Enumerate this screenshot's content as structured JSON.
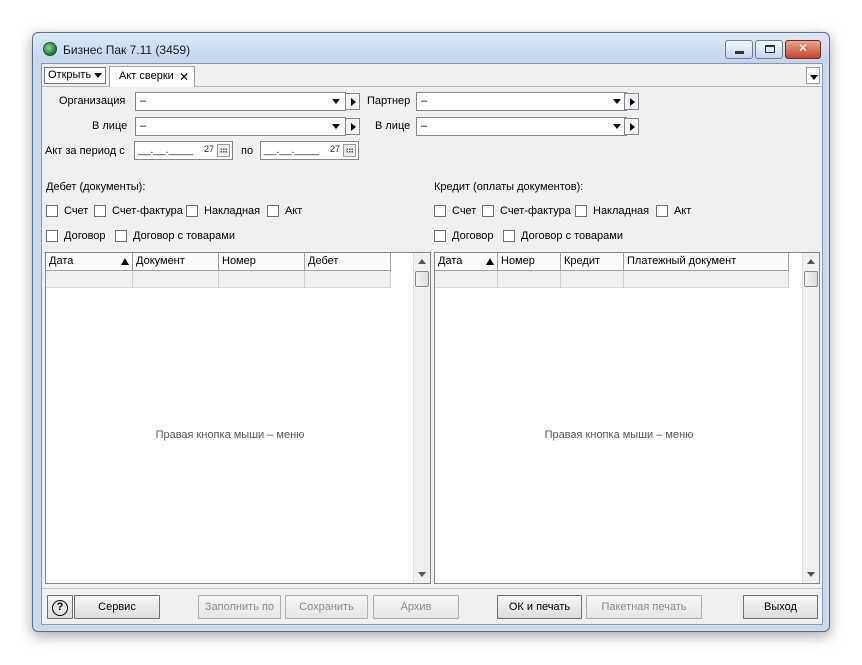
{
  "window": {
    "title": "Бизнес Пак 7.11 (3459)"
  },
  "tabs": {
    "open_label": "Открыть",
    "doc_tab_label": "Акт сверки",
    "close_glyph": "✕"
  },
  "form": {
    "org_label": "Организация",
    "org_value": "–",
    "partner_label": "Партнер",
    "partner_value": "–",
    "face_label_left": "В лице",
    "face_value_left": "–",
    "face_label_right": "В лице",
    "face_value_right": "–",
    "period_label": "Акт за период с",
    "date_from": "__.__.____",
    "date_from_day": "27",
    "to_label": "по",
    "date_to": "__.__.____",
    "date_to_day": "27"
  },
  "debit": {
    "title": "Дебет (документы):",
    "checks": [
      "Счет",
      "Счет-фактура",
      "Накладная",
      "Акт",
      "Договор",
      "Договор с товарами"
    ],
    "columns": [
      "Дата",
      "Документ",
      "Номер",
      "Дебет"
    ],
    "hint": "Правая кнопка мыши – меню"
  },
  "credit": {
    "title": "Кредит (оплаты документов):",
    "checks": [
      "Счет",
      "Счет-фактура",
      "Накладная",
      "Акт",
      "Договор",
      "Договор с товарами"
    ],
    "columns": [
      "Дата",
      "Номер",
      "Кредит",
      "Платежный документ"
    ],
    "hint": "Правая кнопка мыши – меню"
  },
  "buttons": {
    "help": "?",
    "service": "Сервис",
    "fill": "Заполнить по",
    "save": "Сохранить",
    "archive": "Архив",
    "ok_print": "ОК и печать",
    "batch_print": "Пакетная печать",
    "exit": "Выход"
  },
  "colors": {
    "window_frame": "#c9d9ee",
    "close_button": "#c4442a",
    "panel_bg": "#f0f0f0"
  },
  "icons": [
    "app-logo-icon",
    "minimize-icon",
    "maximize-icon",
    "close-icon",
    "dropdown-arrow-icon",
    "play-arrow-icon",
    "calendar-icon",
    "sort-ascending-icon",
    "help-icon"
  ]
}
